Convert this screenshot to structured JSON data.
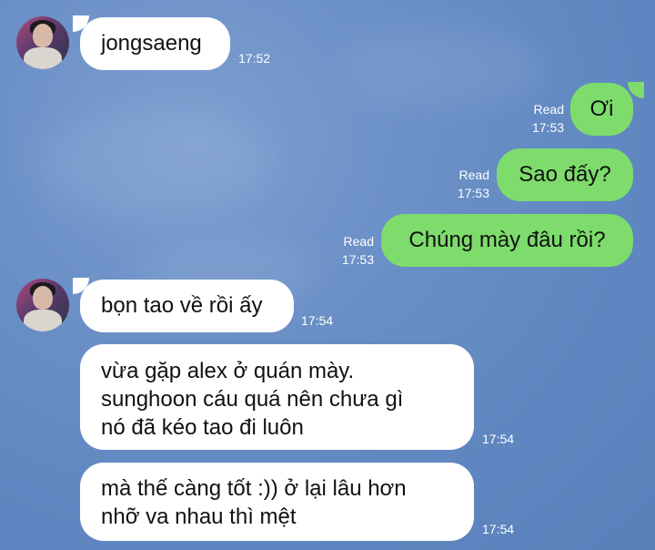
{
  "messages": [
    {
      "direction": "in",
      "text": "jongsaeng",
      "time": "17:52"
    },
    {
      "direction": "out",
      "text": "Ơi",
      "status": "Read",
      "time": "17:53"
    },
    {
      "direction": "out",
      "text": "Sao đấy?",
      "status": "Read",
      "time": "17:53"
    },
    {
      "direction": "out",
      "text": "Chúng mày đâu rồi?",
      "status": "Read",
      "time": "17:53"
    },
    {
      "direction": "in",
      "text": "bọn tao về rồi ấy",
      "time": "17:54"
    },
    {
      "direction": "in",
      "lines": [
        "vừa gặp alex ở quán mày.",
        "sunghoon cáu quá nên chưa gì",
        "nó đã kéo tao đi luôn"
      ],
      "time": "17:54"
    },
    {
      "direction": "in",
      "lines": [
        "mà thế càng tốt :)) ở lại lâu hơn",
        "nhỡ va nhau thì mệt"
      ],
      "time": "17:54"
    }
  ],
  "colors": {
    "incoming_bubble": "#ffffff",
    "outgoing_bubble": "#7ddc6c",
    "background": "#6b90c7"
  }
}
